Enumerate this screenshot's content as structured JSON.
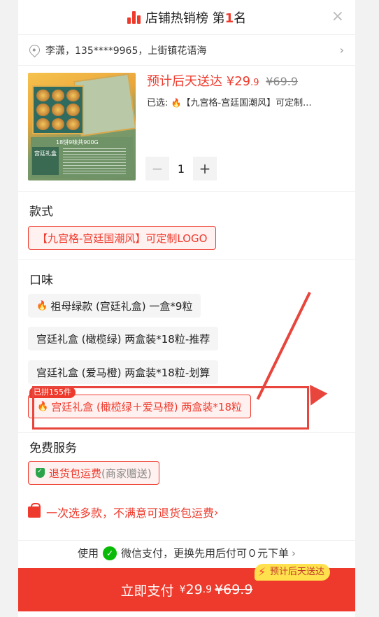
{
  "header": {
    "title": "店铺热销榜 第",
    "rank": "1",
    "suffix": "名",
    "close": "×"
  },
  "address": {
    "text": "李潇，135****9965，上街镇花语海",
    "arrow": "›"
  },
  "product": {
    "image_card_title": "18饼9味共900G",
    "image_tag": "宫廷礼盒",
    "delivery": "预计后天送达",
    "price_symbol": "¥",
    "price_int": "29",
    "price_dec": ".9",
    "orig_price": "¥69.9",
    "selected_prefix": "已选:",
    "selected_value": "【九宫格-宫廷国潮风】可定制...",
    "quantity": "1",
    "minus": "−",
    "plus": "+"
  },
  "style_section": {
    "title": "款式",
    "options": [
      {
        "label": "【九宫格-宫廷国潮风】可定制LOGO",
        "selected": true
      }
    ]
  },
  "flavor_section": {
    "title": "口味",
    "options": [
      {
        "label": "祖母绿款 (宫廷礼盒) 一盒*9粒",
        "hot": true,
        "selected": false
      },
      {
        "label": "宫廷礼盒 (橄榄绿) 两盒装*18粒-推荐",
        "hot": false,
        "selected": false
      },
      {
        "label": "宫廷礼盒 (爱马橙) 两盒装*18粒-划算",
        "hot": false,
        "selected": false
      },
      {
        "label": "宫廷礼盒 (橄榄绿＋爱马橙) 两盒装*18粒",
        "hot": true,
        "selected": true
      }
    ],
    "sold_badge": "已拼155件"
  },
  "service_section": {
    "title": "免费服务",
    "chip_label": "退货包运费",
    "chip_note": "(商家赠送)"
  },
  "promo": {
    "text": "一次选多款，不满意可退货包运费",
    "arrow": "›"
  },
  "pay_note": {
    "prefix": "使用",
    "method": "微信支付，更换先用后付可０元下单",
    "arrow": "›"
  },
  "pay_bar": {
    "label": "立即支付",
    "price_symbol": "¥",
    "price_int": "29",
    "price_dec": ".9",
    "orig_price": "¥69.9",
    "delivery_tag": "预计后天送达"
  },
  "colors": {
    "accent": "#ee3a2c",
    "annotation": "#e8453c",
    "wechat": "#09bb07",
    "tag_yellow": "#ffe14d"
  }
}
